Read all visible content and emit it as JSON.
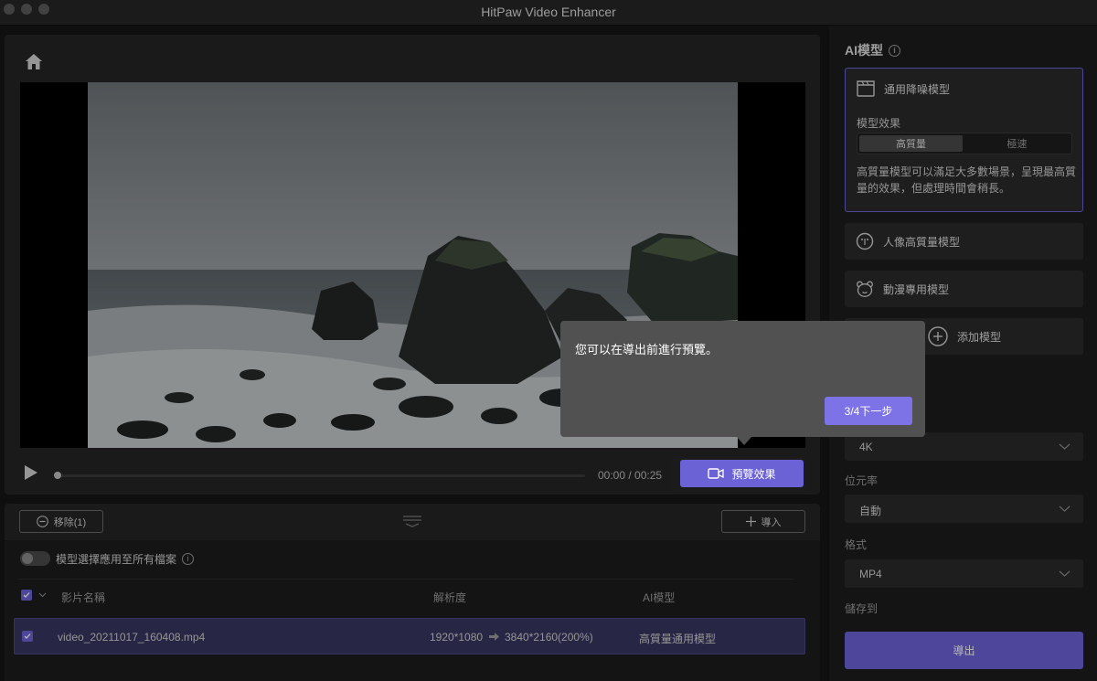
{
  "window": {
    "title": "HitPaw Video Enhancer"
  },
  "player": {
    "time": "00:00 / 00:25",
    "preview_label": "預覽效果"
  },
  "list": {
    "remove_label": "移除(1)",
    "import_label": "導入",
    "apply_all_label": "模型選擇應用至所有檔案",
    "columns": {
      "name": "影片名稱",
      "resolution": "解析度",
      "model": "AI模型"
    },
    "rows": [
      {
        "name": "video_20211017_160408.mp4",
        "resolution_from": "1920*1080",
        "resolution_to": "3840*2160(200%)",
        "model": "高質量通用模型"
      }
    ]
  },
  "sidebar": {
    "title": "AI模型",
    "models": [
      {
        "label": "通用降噪模型",
        "icon": "clapperboard-icon"
      },
      {
        "label": "人像高質量模型",
        "icon": "face-icon"
      },
      {
        "label": "動漫專用模型",
        "icon": "bear-icon"
      },
      {
        "label": "添加模型",
        "icon": "plus-circle-icon"
      }
    ],
    "effect_label": "模型效果",
    "effect_options": [
      "高質量",
      "極速"
    ],
    "effect_selected": "高質量",
    "description": "高質量模型可以滿足大多數場景，呈現最高質量的效果，但處理時間會稍長。",
    "resolution_value": "4K",
    "bitrate_label": "位元率",
    "bitrate_value": "自動",
    "format_label": "格式",
    "format_value": "MP4",
    "save_to_label": "儲存到",
    "export_label": "導出"
  },
  "tooltip": {
    "text": "您可以在導出前進行預覽。",
    "next_label": "3/4下一步"
  },
  "colors": {
    "accent": "#6b62d6",
    "panel": "#242424",
    "background": "#161616"
  }
}
